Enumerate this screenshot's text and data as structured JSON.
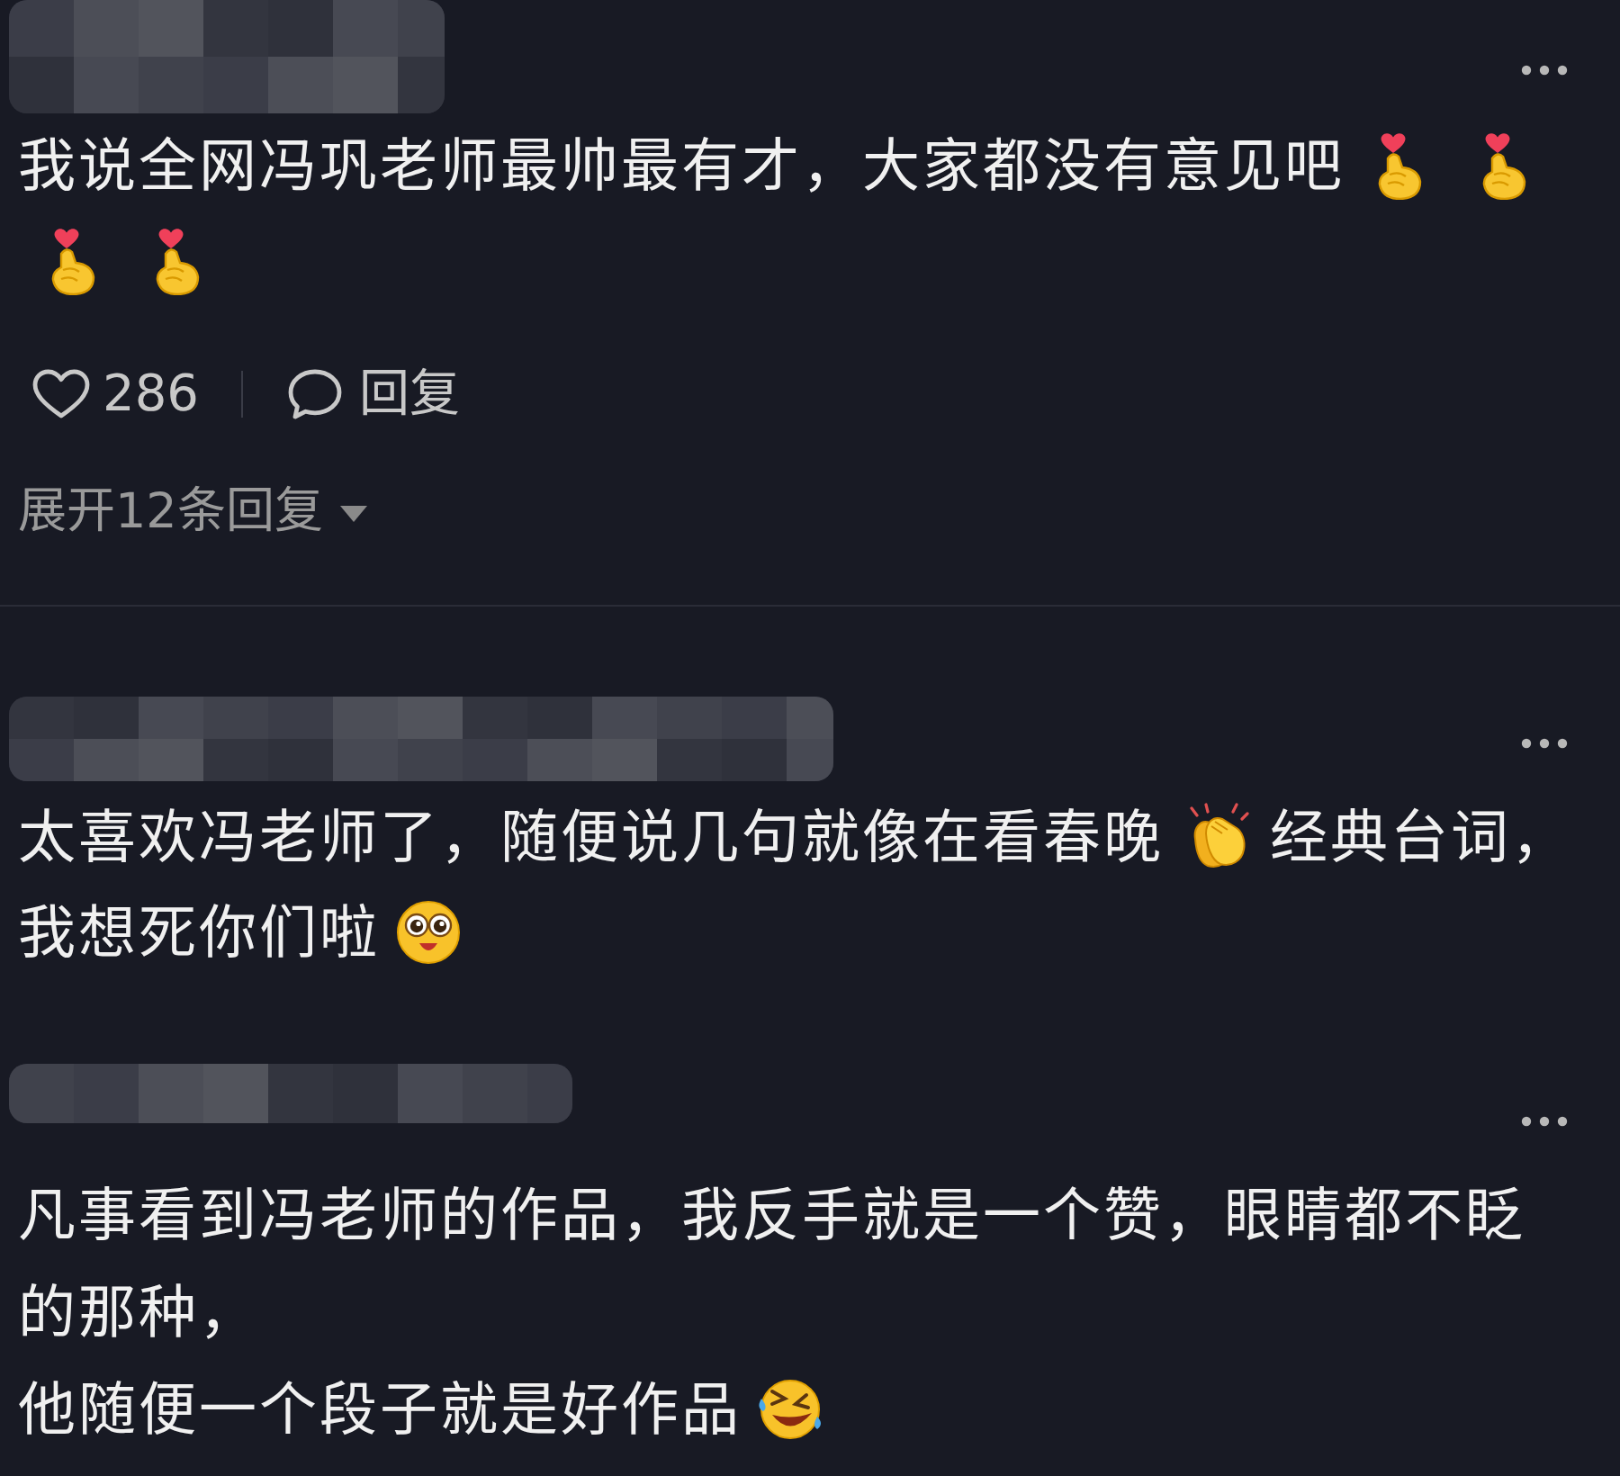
{
  "comments": [
    {
      "body_lines": [
        [
          {
            "kind": "text",
            "text": "我说全网冯巩老师最帅最有才，大家都没有意见吧"
          },
          {
            "kind": "fingerheart"
          },
          {
            "kind": "fingerheart"
          }
        ],
        [
          {
            "kind": "fingerheart"
          },
          {
            "kind": "fingerheart"
          }
        ]
      ],
      "likes": {
        "count": "286",
        "liked": false
      },
      "reply_label": "回复",
      "replies_toggle": {
        "label": "展开12条回复",
        "expanded": false
      }
    },
    {
      "body_lines": [
        [
          {
            "kind": "text",
            "text": "太喜欢冯老师了，随便说几句就像在看春晚"
          },
          {
            "kind": "clap"
          },
          {
            "kind": "text",
            "text": "经典台词，"
          }
        ],
        [
          {
            "kind": "text",
            "text": "我想死你们啦"
          },
          {
            "kind": "starstruck"
          }
        ]
      ]
    },
    {
      "body_lines": [
        [
          {
            "kind": "text",
            "text": "凡事看到冯老师的作品，我反手就是一个赞，眼睛都不眨"
          }
        ],
        [
          {
            "kind": "text",
            "text": "的那种，"
          }
        ],
        [
          {
            "kind": "text",
            "text": "他随便一个段子就是好作品"
          },
          {
            "kind": "rofl"
          }
        ]
      ]
    }
  ]
}
